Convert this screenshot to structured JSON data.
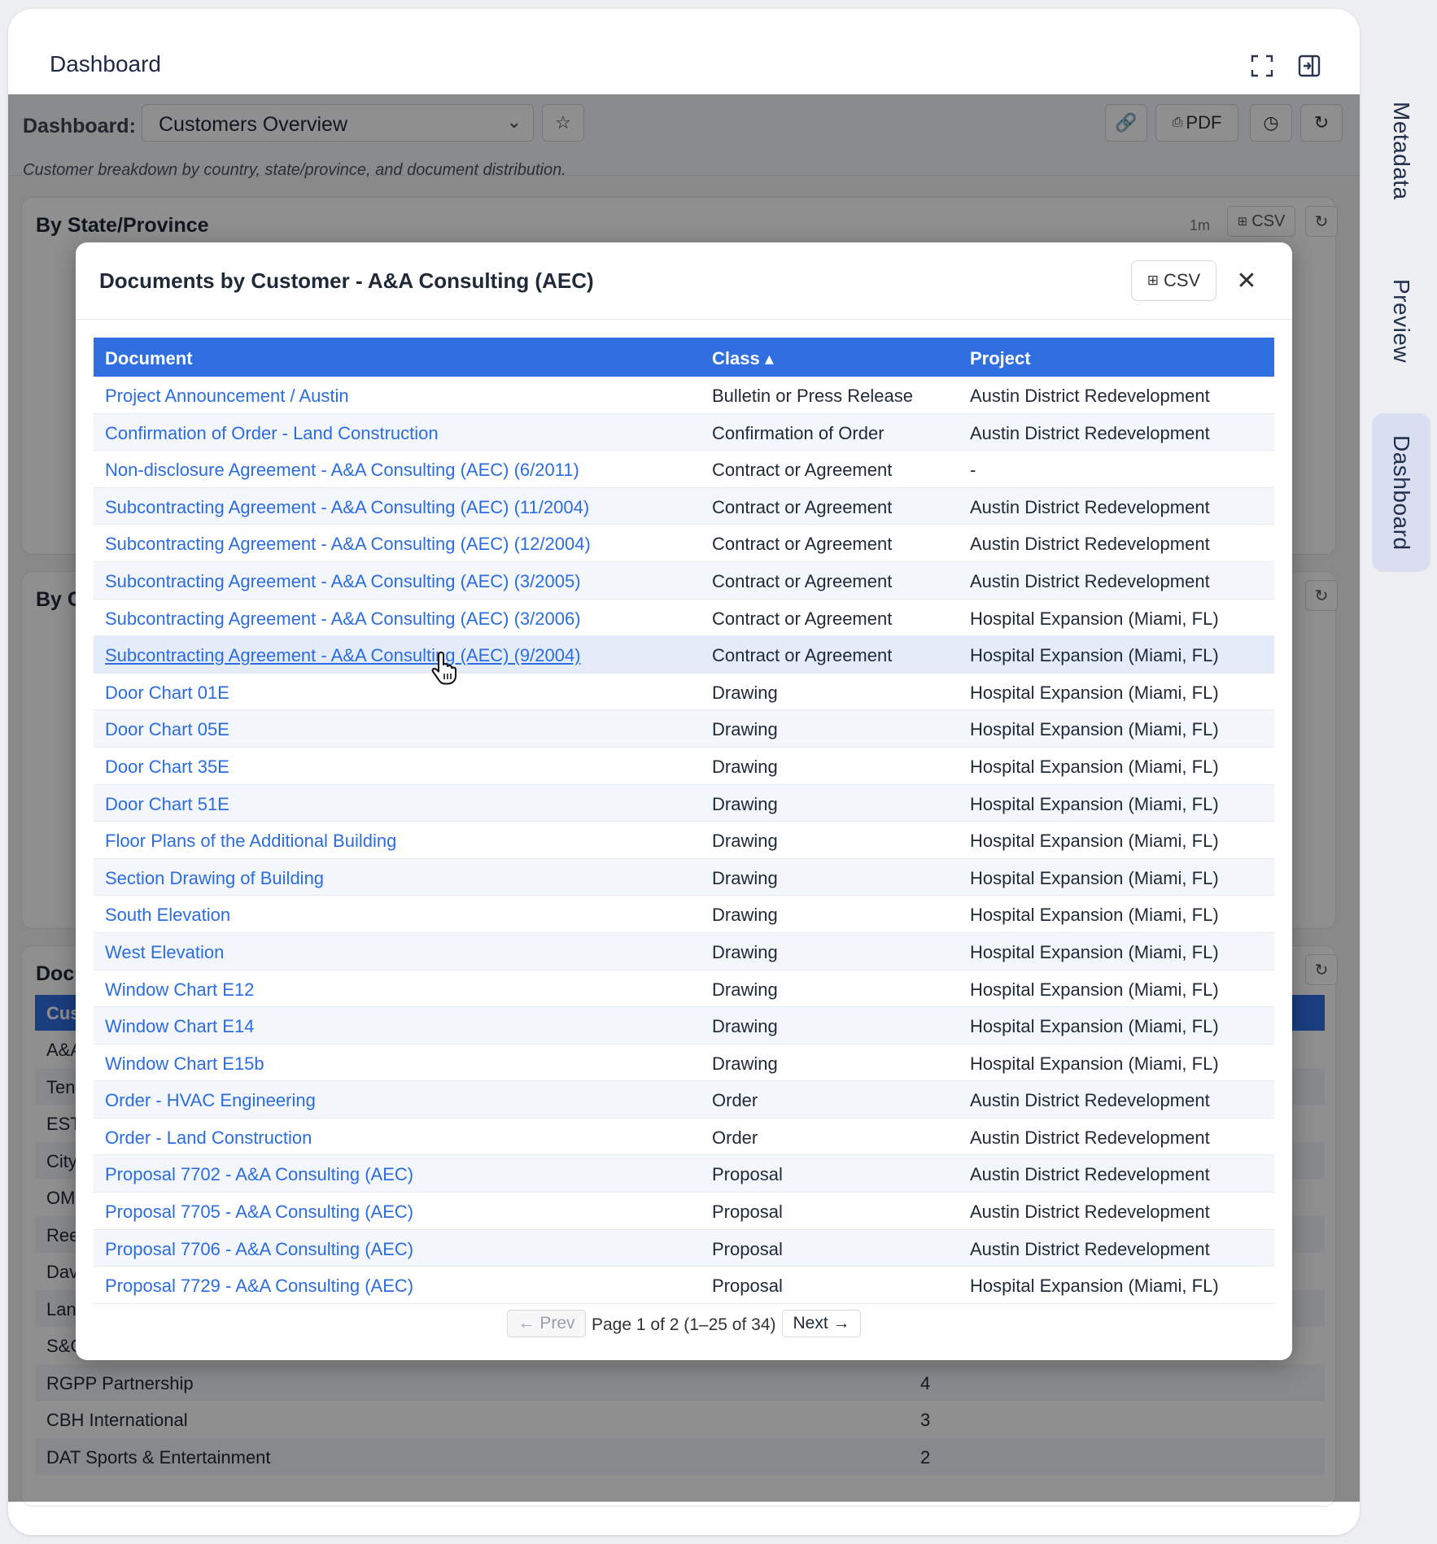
{
  "panel": {
    "title": "Dashboard"
  },
  "toolbar": {
    "label": "Dashboard:",
    "selected_dashboard": "Customers Overview",
    "pdf_label": "PDF",
    "description": "Customer breakdown by country, state/province, and document distribution."
  },
  "cards": {
    "state": {
      "title": "By State/Province",
      "interval": "1m",
      "csv_label": "CSV"
    },
    "country": {
      "title": "By C"
    },
    "docs": {
      "title": "Docu"
    }
  },
  "background_table": {
    "header_first": "Cus",
    "rows": [
      {
        "name": "A&A",
        "count": ""
      },
      {
        "name": "Ten",
        "count": ""
      },
      {
        "name": "EST",
        "count": ""
      },
      {
        "name": "City",
        "count": ""
      },
      {
        "name": "OM",
        "count": ""
      },
      {
        "name": "Ree",
        "count": ""
      },
      {
        "name": "Dav",
        "count": ""
      },
      {
        "name": "Lan",
        "count": ""
      },
      {
        "name": "S&C",
        "count": ""
      },
      {
        "name": "RGPP Partnership",
        "count": "4"
      },
      {
        "name": "CBH International",
        "count": "3"
      },
      {
        "name": "DAT Sports & Entertainment",
        "count": "2"
      }
    ]
  },
  "modal": {
    "title": "Documents by Customer - A&A Consulting (AEC)",
    "csv_label": "CSV",
    "columns": {
      "document": "Document",
      "class": "Class ▴",
      "project": "Project"
    },
    "rows": [
      {
        "document": "Project Announcement / Austin",
        "class": "Bulletin or Press Release",
        "project": "Austin District Redevelopment"
      },
      {
        "document": "Confirmation of Order - Land Construction",
        "class": "Confirmation of Order",
        "project": "Austin District Redevelopment"
      },
      {
        "document": "Non-disclosure Agreement - A&A Consulting (AEC) (6/2011)",
        "class": "Contract or Agreement",
        "project": "-"
      },
      {
        "document": "Subcontracting Agreement - A&A Consulting (AEC) (11/2004)",
        "class": "Contract or Agreement",
        "project": "Austin District Redevelopment"
      },
      {
        "document": "Subcontracting Agreement - A&A Consulting (AEC) (12/2004)",
        "class": "Contract or Agreement",
        "project": "Austin District Redevelopment"
      },
      {
        "document": "Subcontracting Agreement - A&A Consulting (AEC) (3/2005)",
        "class": "Contract or Agreement",
        "project": "Austin District Redevelopment"
      },
      {
        "document": "Subcontracting Agreement - A&A Consulting (AEC) (3/2006)",
        "class": "Contract or Agreement",
        "project": "Hospital Expansion (Miami, FL)"
      },
      {
        "document": "Subcontracting Agreement - A&A Consulting (AEC) (9/2004)",
        "class": "Contract or Agreement",
        "project": "Hospital Expansion (Miami, FL)"
      },
      {
        "document": "Door Chart 01E",
        "class": "Drawing",
        "project": "Hospital Expansion (Miami, FL)"
      },
      {
        "document": "Door Chart 05E",
        "class": "Drawing",
        "project": "Hospital Expansion (Miami, FL)"
      },
      {
        "document": "Door Chart 35E",
        "class": "Drawing",
        "project": "Hospital Expansion (Miami, FL)"
      },
      {
        "document": "Door Chart 51E",
        "class": "Drawing",
        "project": "Hospital Expansion (Miami, FL)"
      },
      {
        "document": "Floor Plans of the Additional Building",
        "class": "Drawing",
        "project": "Hospital Expansion (Miami, FL)"
      },
      {
        "document": "Section Drawing of Building",
        "class": "Drawing",
        "project": "Hospital Expansion (Miami, FL)"
      },
      {
        "document": "South Elevation",
        "class": "Drawing",
        "project": "Hospital Expansion (Miami, FL)"
      },
      {
        "document": "West Elevation",
        "class": "Drawing",
        "project": "Hospital Expansion (Miami, FL)"
      },
      {
        "document": "Window Chart E12",
        "class": "Drawing",
        "project": "Hospital Expansion (Miami, FL)"
      },
      {
        "document": "Window Chart E14",
        "class": "Drawing",
        "project": "Hospital Expansion (Miami, FL)"
      },
      {
        "document": "Window Chart E15b",
        "class": "Drawing",
        "project": "Hospital Expansion (Miami, FL)"
      },
      {
        "document": "Order - HVAC Engineering",
        "class": "Order",
        "project": "Austin District Redevelopment"
      },
      {
        "document": "Order - Land Construction",
        "class": "Order",
        "project": "Austin District Redevelopment"
      },
      {
        "document": "Proposal 7702 - A&A Consulting (AEC)",
        "class": "Proposal",
        "project": "Austin District Redevelopment"
      },
      {
        "document": "Proposal 7705 - A&A Consulting (AEC)",
        "class": "Proposal",
        "project": "Austin District Redevelopment"
      },
      {
        "document": "Proposal 7706 - A&A Consulting (AEC)",
        "class": "Proposal",
        "project": "Austin District Redevelopment"
      },
      {
        "document": "Proposal 7729 - A&A Consulting (AEC)",
        "class": "Proposal",
        "project": "Hospital Expansion (Miami, FL)"
      }
    ],
    "pager": {
      "prev_label": "← Prev",
      "status": "Page 1 of 2 (1–25 of 34)",
      "next_label": "Next →"
    }
  },
  "rail": {
    "tabs": [
      "Metadata",
      "Preview",
      "Dashboard"
    ],
    "active": "Dashboard"
  },
  "colors": {
    "accent": "#2f6fe0",
    "link": "#2b6de0",
    "active_tab": "#d9def0"
  }
}
